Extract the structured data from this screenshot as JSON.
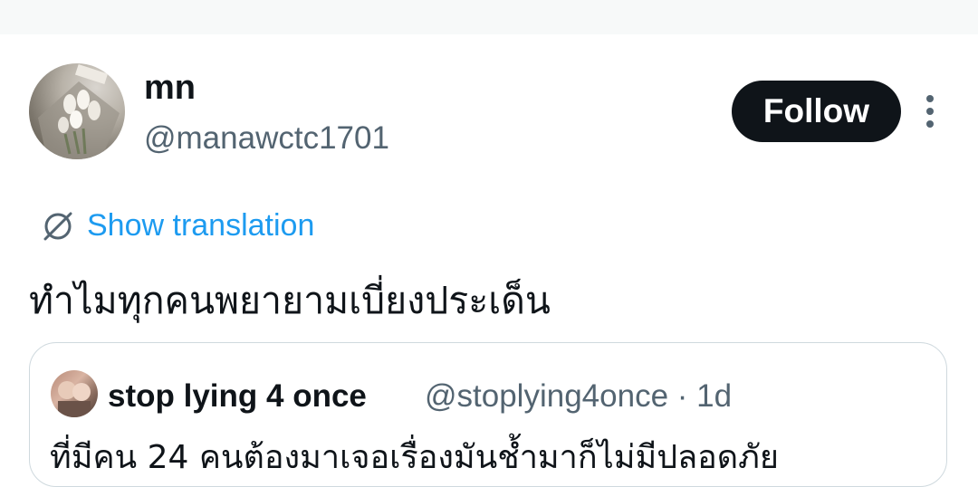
{
  "tweet": {
    "author_name": "mn",
    "author_handle": "@manawctc1701",
    "follow_label": "Follow",
    "translation_label": "Show translation",
    "text": "ทำไมทุกคนพยายามเบี่ยงประเด็น"
  },
  "quoted": {
    "author_name": "stop lying 4 once",
    "handle_time": "@stoplying4once · 1d",
    "text": "ที่มีคน 24 คนต้องมาเจอเรื่องมันช้ำมาก็ไม่มีปลอดภัย"
  },
  "colors": {
    "link": "#1d9bf0",
    "button": "#0f1419",
    "secondary_text": "#536471"
  },
  "icons": [
    "globe-translate-icon",
    "more-options-icon"
  ]
}
